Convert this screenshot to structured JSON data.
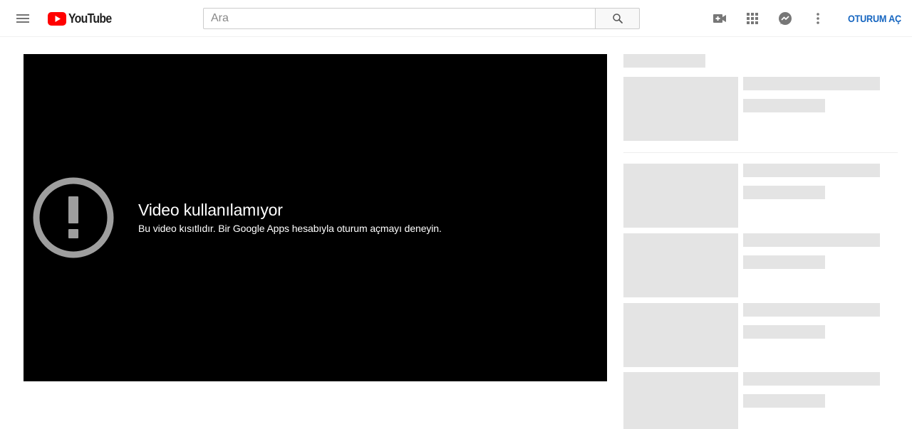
{
  "header": {
    "logo_text": "YouTube",
    "search_placeholder": "Ara",
    "signin_label": "OTURUM AÇ",
    "icons": [
      "menu-icon",
      "search-icon",
      "video-camera-icon",
      "apps-grid-icon",
      "messages-icon",
      "more-vert-icon"
    ]
  },
  "player": {
    "error_title": "Video kullanılamıyor",
    "error_message": "Bu video kısıtlıdır. Bir Google Apps hesabıyla oturum açmayı deneyin."
  },
  "colors": {
    "brand_red": "#ff0000",
    "signin_blue": "#1565c0",
    "skeleton_gray": "#e4e4e4",
    "player_bg": "#000000"
  }
}
